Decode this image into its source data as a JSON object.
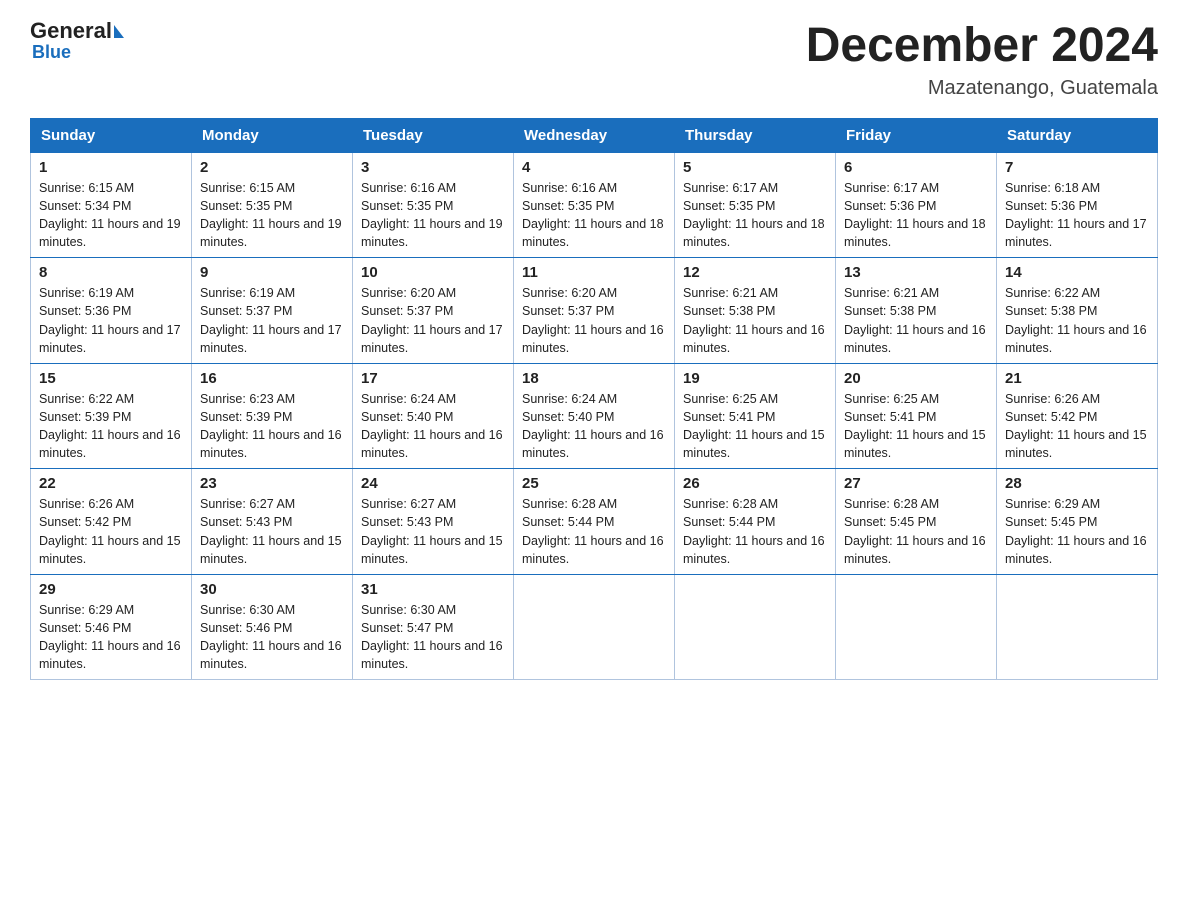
{
  "header": {
    "logo_general": "General",
    "logo_blue": "Blue",
    "month_title": "December 2024",
    "location": "Mazatenango, Guatemala"
  },
  "weekdays": [
    "Sunday",
    "Monday",
    "Tuesday",
    "Wednesday",
    "Thursday",
    "Friday",
    "Saturday"
  ],
  "weeks": [
    [
      {
        "day": "1",
        "sunrise": "Sunrise: 6:15 AM",
        "sunset": "Sunset: 5:34 PM",
        "daylight": "Daylight: 11 hours and 19 minutes."
      },
      {
        "day": "2",
        "sunrise": "Sunrise: 6:15 AM",
        "sunset": "Sunset: 5:35 PM",
        "daylight": "Daylight: 11 hours and 19 minutes."
      },
      {
        "day": "3",
        "sunrise": "Sunrise: 6:16 AM",
        "sunset": "Sunset: 5:35 PM",
        "daylight": "Daylight: 11 hours and 19 minutes."
      },
      {
        "day": "4",
        "sunrise": "Sunrise: 6:16 AM",
        "sunset": "Sunset: 5:35 PM",
        "daylight": "Daylight: 11 hours and 18 minutes."
      },
      {
        "day": "5",
        "sunrise": "Sunrise: 6:17 AM",
        "sunset": "Sunset: 5:35 PM",
        "daylight": "Daylight: 11 hours and 18 minutes."
      },
      {
        "day": "6",
        "sunrise": "Sunrise: 6:17 AM",
        "sunset": "Sunset: 5:36 PM",
        "daylight": "Daylight: 11 hours and 18 minutes."
      },
      {
        "day": "7",
        "sunrise": "Sunrise: 6:18 AM",
        "sunset": "Sunset: 5:36 PM",
        "daylight": "Daylight: 11 hours and 17 minutes."
      }
    ],
    [
      {
        "day": "8",
        "sunrise": "Sunrise: 6:19 AM",
        "sunset": "Sunset: 5:36 PM",
        "daylight": "Daylight: 11 hours and 17 minutes."
      },
      {
        "day": "9",
        "sunrise": "Sunrise: 6:19 AM",
        "sunset": "Sunset: 5:37 PM",
        "daylight": "Daylight: 11 hours and 17 minutes."
      },
      {
        "day": "10",
        "sunrise": "Sunrise: 6:20 AM",
        "sunset": "Sunset: 5:37 PM",
        "daylight": "Daylight: 11 hours and 17 minutes."
      },
      {
        "day": "11",
        "sunrise": "Sunrise: 6:20 AM",
        "sunset": "Sunset: 5:37 PM",
        "daylight": "Daylight: 11 hours and 16 minutes."
      },
      {
        "day": "12",
        "sunrise": "Sunrise: 6:21 AM",
        "sunset": "Sunset: 5:38 PM",
        "daylight": "Daylight: 11 hours and 16 minutes."
      },
      {
        "day": "13",
        "sunrise": "Sunrise: 6:21 AM",
        "sunset": "Sunset: 5:38 PM",
        "daylight": "Daylight: 11 hours and 16 minutes."
      },
      {
        "day": "14",
        "sunrise": "Sunrise: 6:22 AM",
        "sunset": "Sunset: 5:38 PM",
        "daylight": "Daylight: 11 hours and 16 minutes."
      }
    ],
    [
      {
        "day": "15",
        "sunrise": "Sunrise: 6:22 AM",
        "sunset": "Sunset: 5:39 PM",
        "daylight": "Daylight: 11 hours and 16 minutes."
      },
      {
        "day": "16",
        "sunrise": "Sunrise: 6:23 AM",
        "sunset": "Sunset: 5:39 PM",
        "daylight": "Daylight: 11 hours and 16 minutes."
      },
      {
        "day": "17",
        "sunrise": "Sunrise: 6:24 AM",
        "sunset": "Sunset: 5:40 PM",
        "daylight": "Daylight: 11 hours and 16 minutes."
      },
      {
        "day": "18",
        "sunrise": "Sunrise: 6:24 AM",
        "sunset": "Sunset: 5:40 PM",
        "daylight": "Daylight: 11 hours and 16 minutes."
      },
      {
        "day": "19",
        "sunrise": "Sunrise: 6:25 AM",
        "sunset": "Sunset: 5:41 PM",
        "daylight": "Daylight: 11 hours and 15 minutes."
      },
      {
        "day": "20",
        "sunrise": "Sunrise: 6:25 AM",
        "sunset": "Sunset: 5:41 PM",
        "daylight": "Daylight: 11 hours and 15 minutes."
      },
      {
        "day": "21",
        "sunrise": "Sunrise: 6:26 AM",
        "sunset": "Sunset: 5:42 PM",
        "daylight": "Daylight: 11 hours and 15 minutes."
      }
    ],
    [
      {
        "day": "22",
        "sunrise": "Sunrise: 6:26 AM",
        "sunset": "Sunset: 5:42 PM",
        "daylight": "Daylight: 11 hours and 15 minutes."
      },
      {
        "day": "23",
        "sunrise": "Sunrise: 6:27 AM",
        "sunset": "Sunset: 5:43 PM",
        "daylight": "Daylight: 11 hours and 15 minutes."
      },
      {
        "day": "24",
        "sunrise": "Sunrise: 6:27 AM",
        "sunset": "Sunset: 5:43 PM",
        "daylight": "Daylight: 11 hours and 15 minutes."
      },
      {
        "day": "25",
        "sunrise": "Sunrise: 6:28 AM",
        "sunset": "Sunset: 5:44 PM",
        "daylight": "Daylight: 11 hours and 16 minutes."
      },
      {
        "day": "26",
        "sunrise": "Sunrise: 6:28 AM",
        "sunset": "Sunset: 5:44 PM",
        "daylight": "Daylight: 11 hours and 16 minutes."
      },
      {
        "day": "27",
        "sunrise": "Sunrise: 6:28 AM",
        "sunset": "Sunset: 5:45 PM",
        "daylight": "Daylight: 11 hours and 16 minutes."
      },
      {
        "day": "28",
        "sunrise": "Sunrise: 6:29 AM",
        "sunset": "Sunset: 5:45 PM",
        "daylight": "Daylight: 11 hours and 16 minutes."
      }
    ],
    [
      {
        "day": "29",
        "sunrise": "Sunrise: 6:29 AM",
        "sunset": "Sunset: 5:46 PM",
        "daylight": "Daylight: 11 hours and 16 minutes."
      },
      {
        "day": "30",
        "sunrise": "Sunrise: 6:30 AM",
        "sunset": "Sunset: 5:46 PM",
        "daylight": "Daylight: 11 hours and 16 minutes."
      },
      {
        "day": "31",
        "sunrise": "Sunrise: 6:30 AM",
        "sunset": "Sunset: 5:47 PM",
        "daylight": "Daylight: 11 hours and 16 minutes."
      },
      {
        "day": "",
        "sunrise": "",
        "sunset": "",
        "daylight": ""
      },
      {
        "day": "",
        "sunrise": "",
        "sunset": "",
        "daylight": ""
      },
      {
        "day": "",
        "sunrise": "",
        "sunset": "",
        "daylight": ""
      },
      {
        "day": "",
        "sunrise": "",
        "sunset": "",
        "daylight": ""
      }
    ]
  ]
}
